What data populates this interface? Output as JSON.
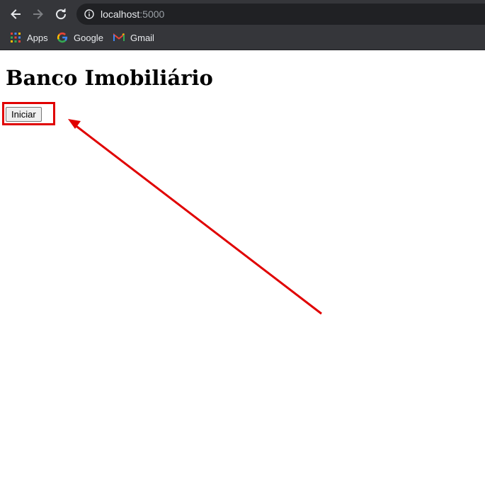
{
  "browser": {
    "url_host": "localhost",
    "url_port": ":5000",
    "bookmarks": [
      {
        "label": "Apps",
        "icon": "apps-grid-icon"
      },
      {
        "label": "Google",
        "icon": "google-icon"
      },
      {
        "label": "Gmail",
        "icon": "gmail-icon"
      }
    ]
  },
  "page": {
    "title": "Banco Imobiliário",
    "start_button_label": "Iniciar"
  },
  "annotation": {
    "color": "#e00000"
  }
}
